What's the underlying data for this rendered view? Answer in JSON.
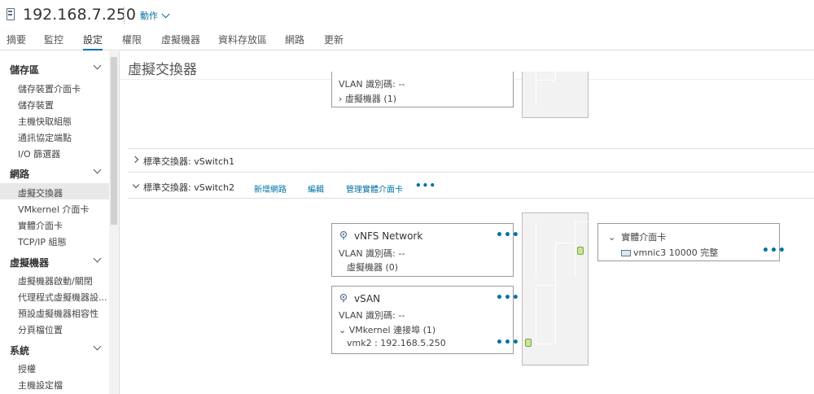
{
  "header": {
    "host_title": "192.168.7.250",
    "actions_label": "動作"
  },
  "tabs": [
    {
      "label": "摘要"
    },
    {
      "label": "監控"
    },
    {
      "label": "設定"
    },
    {
      "label": "權限"
    },
    {
      "label": "虛擬機器"
    },
    {
      "label": "資料存放區"
    },
    {
      "label": "網路"
    },
    {
      "label": "更新"
    }
  ],
  "active_tab": "設定",
  "sidebar": {
    "sections": [
      {
        "label": "儲存區",
        "items": [
          "儲存裝置介面卡",
          "儲存裝置",
          "主機快取組態",
          "通訊協定端點",
          "I/O 篩選器"
        ]
      },
      {
        "label": "網路",
        "items": [
          "虛擬交換器",
          "VMkernel 介面卡",
          "實體介面卡",
          "TCP/IP 組態"
        ]
      },
      {
        "label": "虛擬機器",
        "items": [
          "虛擬機器啟動/關閉",
          "代理程式虛擬機器設...",
          "預設虛擬機器相容性",
          "分頁檔位置"
        ]
      },
      {
        "label": "系統",
        "items": [
          "授權",
          "主機設定檔"
        ]
      }
    ],
    "selected_item": "虛擬交換器"
  },
  "main": {
    "title": "虛擬交換器",
    "top_card": {
      "vlan": "VLAN 識別碼: --",
      "vms": "虛擬機器 (1)"
    },
    "vswitch1": {
      "label": "標準交換器: vSwitch1"
    },
    "vswitch2": {
      "label": "標準交換器: vSwitch2",
      "actions": [
        "新增網路",
        "編輯",
        "管理實體介面卡"
      ],
      "more": "•••"
    },
    "nfs_card": {
      "title": "vNFS Network",
      "vlan": "VLAN 識別碼: --",
      "vms": "虛擬機器 (0)"
    },
    "vsan_card": {
      "title": "vSAN",
      "vlan": "VLAN 識別碼: --",
      "vmk_group": "VMkernel 連接埠 (1)",
      "vmk": "vmk2 : 192.168.5.250"
    },
    "physical_card": {
      "title": "實體介面卡",
      "nic": "vmnic3 10000 完整"
    }
  },
  "colors": {
    "accent": "#0072a3",
    "port_green": "#c6e59a"
  }
}
